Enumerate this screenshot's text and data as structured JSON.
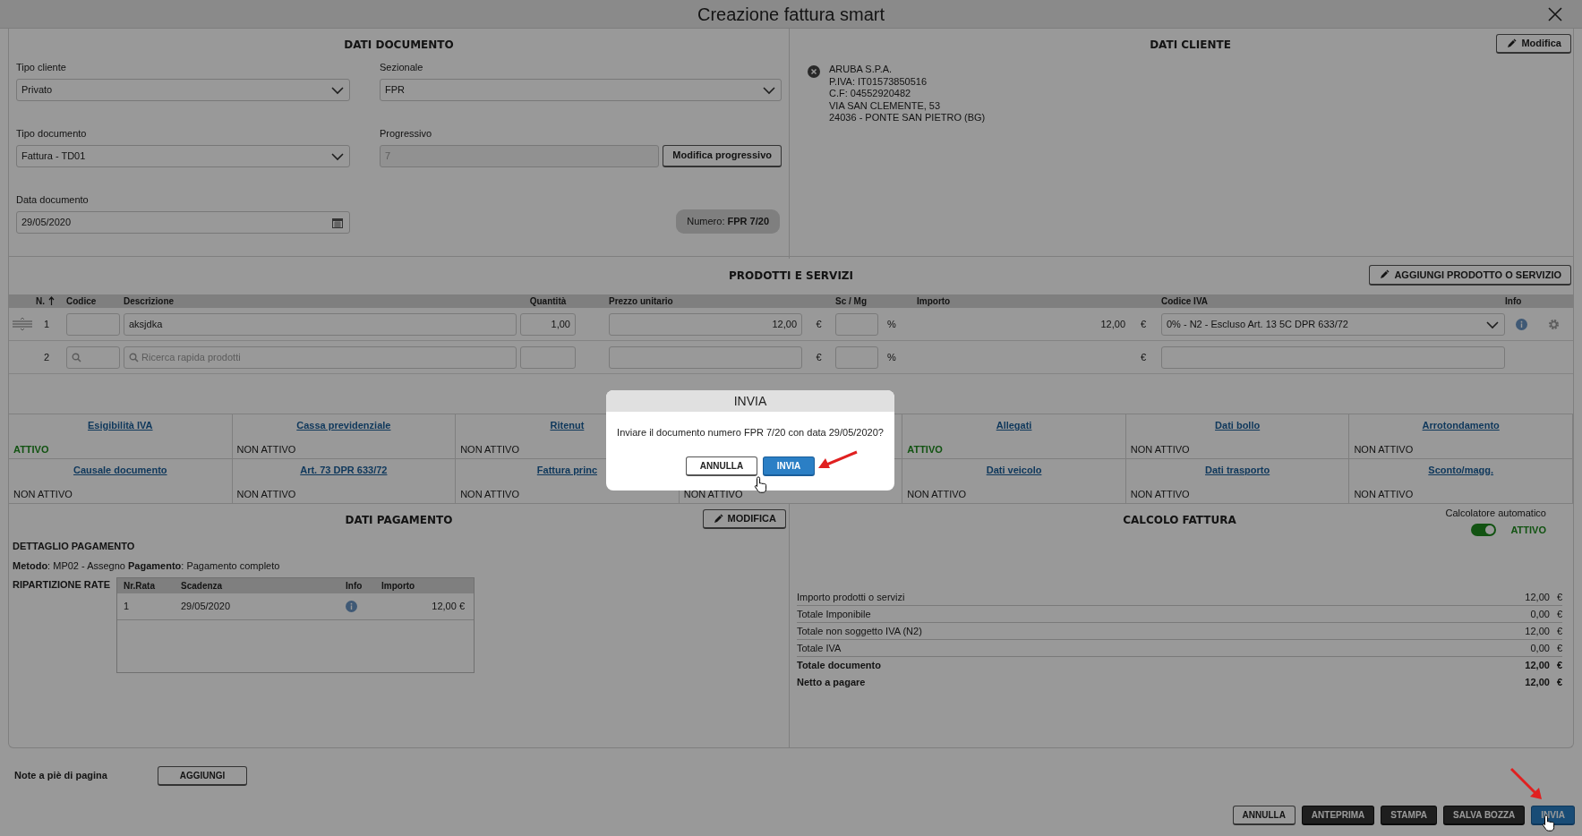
{
  "window": {
    "title": "Creazione fattura smart"
  },
  "documento": {
    "title": "DATI DOCUMENTO",
    "fields": [
      {
        "label": "Tipo cliente",
        "kind": "select",
        "value": "Privato"
      },
      {
        "label": "Sezionale",
        "kind": "select",
        "value": "FPR"
      },
      {
        "label": "Tipo documento",
        "kind": "select",
        "value": "Fattura - TD01"
      },
      {
        "label": "Progressivo",
        "kind": "readonly",
        "value": "7",
        "button": "Modifica progressivo"
      },
      {
        "label": "Data documento",
        "kind": "date",
        "value": "29/05/2020"
      }
    ],
    "numero": "Numero: **FPR 7/20**"
  },
  "cliente": {
    "title": "DATI CLIENTE",
    "edit_button": "Modifica",
    "lines": [
      "ARUBA S.P.A.",
      "P.IVA: IT01573850516",
      "C.F: 04552920482",
      "VIA SAN CLEMENTE, 53",
      "24036 - PONTE SAN PIETRO (BG)"
    ]
  },
  "prodotti": {
    "title": "PRODOTTI E SERVIZI",
    "add_button": "AGGIUNGI PRODOTTO O SERVIZIO",
    "columns": [
      "N.",
      "Codice",
      "Descrizione",
      "Quantità",
      "Prezzo unitario",
      "Sc / Mg",
      "Importo",
      "Codice IVA",
      "Info"
    ],
    "rows": [
      {
        "kind": "item",
        "n": "1",
        "description": "aksjdka",
        "quantity": "1,00",
        "unit_price": "12,00",
        "price_currency": "€",
        "discount_unit": "%",
        "amount": "12,00",
        "amount_currency": "€",
        "vat_code": "0% - N2 - Escluso Art. 13 5C DPR 633/72"
      },
      {
        "kind": "search",
        "n": "2",
        "description_placeholder": "Ricerca rapida prodotti",
        "price_currency": "€",
        "discount_unit": "%",
        "amount_currency": "€"
      }
    ]
  },
  "options": [
    [
      {
        "title": "Esigibilità IVA",
        "status": "ATTIVO",
        "active": true
      },
      {
        "title": "Cassa previdenziale",
        "status": "NON ATTIVO",
        "active": false
      },
      {
        "title": "Ritenut",
        "status": "NON ATTIVO",
        "active": false
      },
      {
        "title": "Allegati",
        "status": "ATTIVO",
        "active": true
      },
      {
        "title": "Dati bollo",
        "status": "NON ATTIVO",
        "active": false
      },
      {
        "title": "Arrotondamento",
        "status": "NON ATTIVO",
        "active": false
      }
    ],
    [
      {
        "title": "Causale documento",
        "status": "NON ATTIVO",
        "active": false
      },
      {
        "title": "Art. 73 DPR 633/72",
        "status": "NON ATTIVO",
        "active": false
      },
      {
        "title": "Fattura princ",
        "status": "NON ATTIVO",
        "active": false
      },
      {
        "status": "NON ATTIVO",
        "active": false
      },
      {
        "title": "Dati veicolo",
        "status": "NON ATTIVO",
        "active": false
      },
      {
        "title": "Dati trasporto",
        "status": "NON ATTIVO",
        "active": false
      },
      {
        "title": "Sconto/magg.",
        "status": "NON ATTIVO",
        "active": false
      }
    ]
  ],
  "pagamento": {
    "title": "DATI PAGAMENTO",
    "edit_button": "MODIFICA",
    "detail_title": "DETTAGLIO PAGAMENTO",
    "method": "**Metodo**: MP02 - Assegno **Pagamento**: Pagamento completo",
    "rate_title": "RIPARTIZIONE RATE",
    "rate_columns": [
      "Nr.Rata",
      "Scadenza",
      "Info",
      "Importo"
    ],
    "rates": [
      {
        "n": "1",
        "due": "29/05/2020",
        "amount": "12,00 €"
      }
    ]
  },
  "calcolo": {
    "title": "CALCOLO FATTURA",
    "auto_label": "Calcolatore automatico",
    "auto_on": true,
    "auto_status": "ATTIVO",
    "rows": [
      {
        "label": "Importo prodotti o servizi",
        "value": "12,00",
        "currency": "€",
        "bold": false
      },
      {
        "label": "Totale Imponibile",
        "value": "0,00",
        "currency": "€",
        "bold": false
      },
      {
        "label": "Totale non soggetto IVA (N2)",
        "value": "12,00",
        "currency": "€",
        "bold": false
      },
      {
        "label": "Totale IVA",
        "value": "0,00",
        "currency": "€",
        "bold": false
      },
      {
        "label": "Totale documento",
        "value": "12,00",
        "currency": "€",
        "bold": true
      },
      {
        "label": "Netto a pagare",
        "value": "12,00",
        "currency": "€",
        "bold": true
      }
    ]
  },
  "notes": {
    "label": "Note a piè di pagina",
    "button": "AGGIUNGI"
  },
  "actions": [
    {
      "label": "ANNULLA",
      "kind": "outline"
    },
    {
      "label": "ANTEPRIMA",
      "kind": "dark"
    },
    {
      "label": "STAMPA",
      "kind": "dark"
    },
    {
      "label": "SALVA BOZZA",
      "kind": "dark"
    },
    {
      "label": "INVIA",
      "kind": "primary"
    }
  ],
  "dialog": {
    "title": "INVIA",
    "message": "Inviare il documento numero FPR 7/20 con data 29/05/2020?",
    "buttons": [
      {
        "label": "ANNULLA",
        "kind": "outline"
      },
      {
        "label": "INVIA",
        "kind": "primary"
      }
    ]
  }
}
